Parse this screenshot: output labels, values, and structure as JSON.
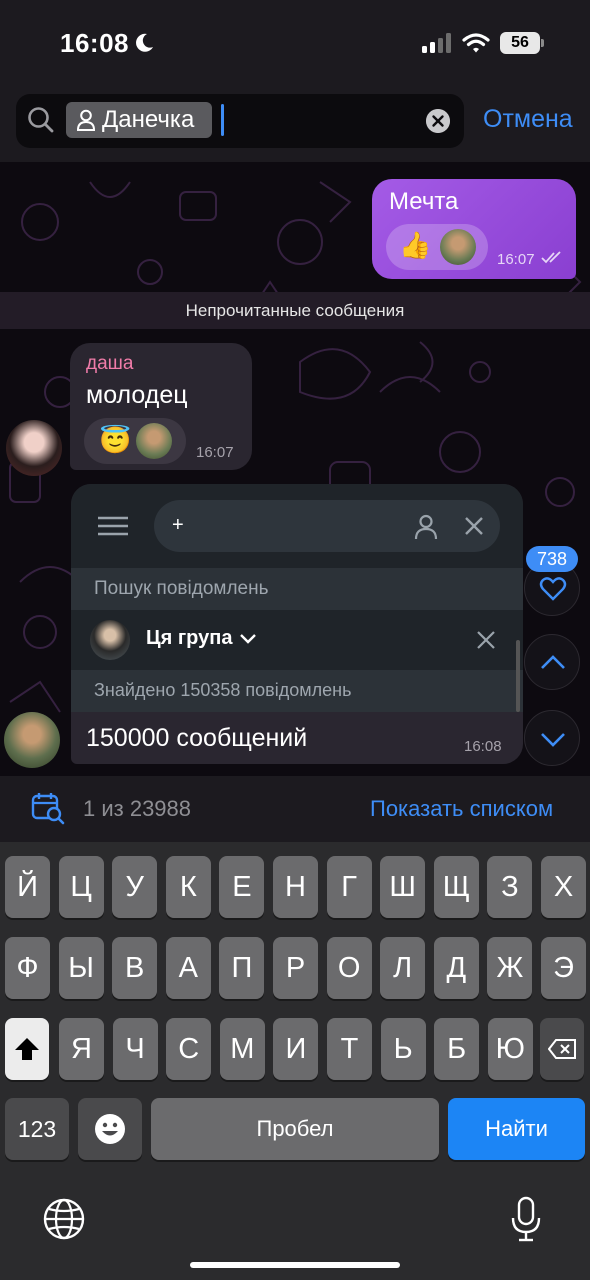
{
  "status_bar": {
    "time": "16:08",
    "battery": "56"
  },
  "search": {
    "chip_label": "Данечка",
    "cancel_label": "Отмена"
  },
  "messages": {
    "outgoing": {
      "text": "Мечта",
      "time": "16:07",
      "reaction_emoji": "👍"
    },
    "unread_divider": "Непрочитанные сообщения",
    "incoming": {
      "sender": "даша",
      "text": "молодец",
      "time": "16:07",
      "reaction_emoji": "😇"
    },
    "embedded": {
      "input_text": "+",
      "search_label": "Пошук повідомлень",
      "group_label": "Ця група",
      "found_label": "Знайдено 150358 повідомлень",
      "caption": "150000 сообщений",
      "time": "16:08"
    }
  },
  "floating": {
    "reaction_count": "738"
  },
  "results": {
    "count": "1 из 23988",
    "show_list_label": "Показать списком"
  },
  "keyboard": {
    "row1": [
      "Й",
      "Ц",
      "У",
      "К",
      "Е",
      "Н",
      "Г",
      "Ш",
      "Щ",
      "З",
      "Х"
    ],
    "row2": [
      "Ф",
      "Ы",
      "В",
      "А",
      "П",
      "Р",
      "О",
      "Л",
      "Д",
      "Ж",
      "Э"
    ],
    "row3": [
      "Я",
      "Ч",
      "С",
      "М",
      "И",
      "Т",
      "Ь",
      "Б",
      "Ю"
    ],
    "numbers_label": "123",
    "space_label": "Пробел",
    "search_label": "Найти"
  },
  "colors": {
    "accent": "#3e8df6",
    "bubble_out": "#9b4fe0",
    "bubble_in": "#2a2630",
    "sender_name": "#f07ca9"
  }
}
